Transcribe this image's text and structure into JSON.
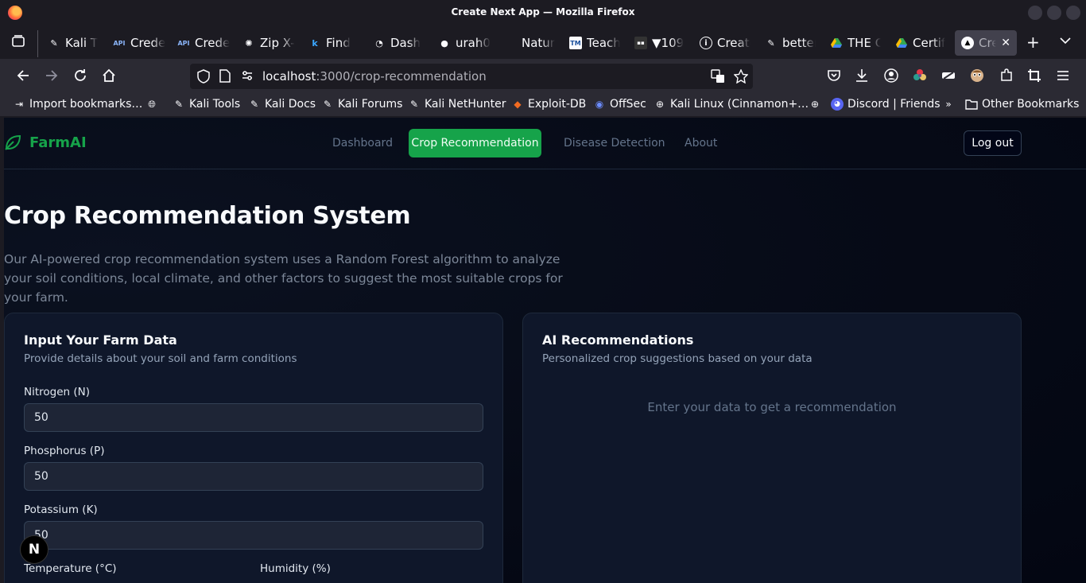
{
  "window": {
    "title": "Create Next App — Mozilla Firefox"
  },
  "tabs": [
    {
      "label": "Kali T",
      "icon": "kali-dragon-icon"
    },
    {
      "label": "Crede",
      "icon": "api-icon"
    },
    {
      "label": "Crede",
      "icon": "api-icon"
    },
    {
      "label": "Zip X-",
      "icon": "openai-icon"
    },
    {
      "label": "Find",
      "icon": "k-icon"
    },
    {
      "label": "Dash",
      "icon": "dashboard-icon"
    },
    {
      "label": "urah0",
      "icon": "github-icon"
    },
    {
      "label": "Natur",
      "icon": "blank-icon"
    },
    {
      "label": "Teach",
      "icon": "tm-icon"
    },
    {
      "label": "▼109",
      "icon": "site-icon"
    },
    {
      "label": "Create",
      "icon": "info-icon"
    },
    {
      "label": "better",
      "icon": "kali-dragon-icon"
    },
    {
      "label": "THE C",
      "icon": "drive-icon"
    },
    {
      "label": "Certif",
      "icon": "drive-icon"
    },
    {
      "label": "Cre",
      "icon": "nextjs-icon",
      "active": true
    }
  ],
  "tab_glyphs": {
    "close": "✕",
    "new_tab": "+",
    "list_all": "⌄"
  },
  "urlbar": {
    "host": "localhost",
    "path": ":3000/crop-recommendation"
  },
  "bookmarks": [
    {
      "label": "Import bookmarks…",
      "icon": "import-icon"
    },
    {
      "label": "",
      "icon": "globe-icon"
    },
    {
      "label": "Kali Tools",
      "icon": "kali-dragon-icon"
    },
    {
      "label": "Kali Docs",
      "icon": "kali-dragon-icon"
    },
    {
      "label": "Kali Forums",
      "icon": "kali-dragon-icon"
    },
    {
      "label": "Kali NetHunter",
      "icon": "kali-dragon-icon"
    },
    {
      "label": "Exploit-DB",
      "icon": "exploit-db-icon"
    },
    {
      "label": "OffSec",
      "icon": "offsec-icon"
    },
    {
      "label": "Kali Linux (Cinnamon+…",
      "icon": "globe-icon"
    },
    {
      "label": "",
      "icon": "globe-icon"
    },
    {
      "label": "Discord | Friends",
      "icon": "discord-icon"
    },
    {
      "label": "",
      "icon": "chevrons-right-icon"
    },
    {
      "label": "Other Bookmarks",
      "icon": "folder-icon"
    }
  ],
  "app": {
    "brand": "FarmAI",
    "nav": {
      "dashboard": "Dashboard",
      "crop": "Crop Recommendation",
      "disease": "Disease Detection",
      "about": "About",
      "logout": "Log out"
    },
    "heading": "Crop Recommendation System",
    "lead": "Our AI-powered crop recommendation system uses a Random Forest algorithm to analyze your soil conditions, local climate, and other factors to suggest the most suitable crops for your farm.",
    "input_card": {
      "title": "Input Your Farm Data",
      "description": "Provide details about your soil and farm conditions",
      "fields": {
        "nitrogen": {
          "label": "Nitrogen (N)",
          "value": "50"
        },
        "phosphorus": {
          "label": "Phosphorus (P)",
          "value": "50"
        },
        "potassium": {
          "label": "Potassium (K)",
          "value": "50"
        },
        "temperature": {
          "label": "Temperature (°C)"
        },
        "humidity": {
          "label": "Humidity (%)"
        }
      }
    },
    "result_card": {
      "title": "AI Recommendations",
      "description": "Personalized crop suggestions based on your data",
      "empty": "Enter your data to get a recommendation"
    },
    "next_badge": "N"
  },
  "colors": {
    "accent": "#16a34a",
    "page_bg": "#060a16",
    "card_bg": "#0f172a"
  }
}
